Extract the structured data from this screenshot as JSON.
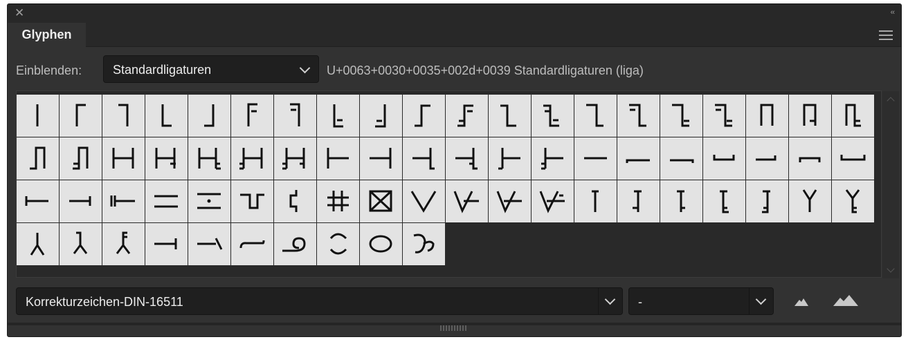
{
  "window": {
    "close_icon": "close-icon",
    "collapse_label": "‹‹"
  },
  "tabs": [
    {
      "label": "Glyphen"
    }
  ],
  "show_row": {
    "label": "Einblenden:",
    "select_value": "Standardligaturen",
    "info": "U+0063+0030+0035+002d+0039 Standardligaturen (liga)"
  },
  "glyphs": [
    "bar-vertical",
    "corner-top-left",
    "corner-top-right",
    "corner-bottom-left",
    "corner-bottom-right",
    "corner-top-left-double",
    "corner-top-right-double",
    "corner-bottom-left-double",
    "corner-bottom-right-double",
    "step-up-right",
    "step-up-right-double",
    "step-down-right",
    "step-down-right-double",
    "step-right-down",
    "step-right-down-double-a",
    "step-right-down-double-b",
    "step-right-down-double-c",
    "arch",
    "arch-right-double-a",
    "arch-right-double-b",
    "arch-left-double-a",
    "arch-left-double-b",
    "h-bracket",
    "h-bracket-right-double-a",
    "h-bracket-right-double-b",
    "h-bracket-left-double-a",
    "h-bracket-left-double-b",
    "tee-left",
    "tee-right",
    "tee-right-double-a",
    "tee-right-double-b",
    "tee-left-double-a",
    "tee-left-double-b",
    "line-horizontal",
    "hook-left",
    "hook-right",
    "cup",
    "cup-right",
    "cap",
    "cup-open",
    "i-beam-horizontal",
    "i-beam-right",
    "i-beam-double-left",
    "double-line",
    "divide",
    "meander",
    "zigzag-hook",
    "hash",
    "boxed-x",
    "v-check",
    "v-check-double-a",
    "v-check-double-b",
    "v-check-double-c",
    "t-up",
    "t-up-double-a",
    "t-up-double-b",
    "t-up-double-c",
    "t-up-double-d",
    "y-up",
    "y-up-double",
    "y-down",
    "y-down-double-a",
    "y-down-double-b",
    "arrow-right",
    "arrow-left-tail",
    "wave-line",
    "loop-line",
    "circle-open",
    "ellipse",
    "curl"
  ],
  "font_select": {
    "value": "Korrekturzeichen-DIN-16511"
  },
  "style_select": {
    "value": "-"
  },
  "zoom": {
    "small_icon": "zoom-out-icon",
    "large_icon": "zoom-in-icon"
  },
  "colors": {
    "panel_bg": "#323232",
    "cell_bg": "#e3e3e3",
    "glyph": "#111111"
  }
}
